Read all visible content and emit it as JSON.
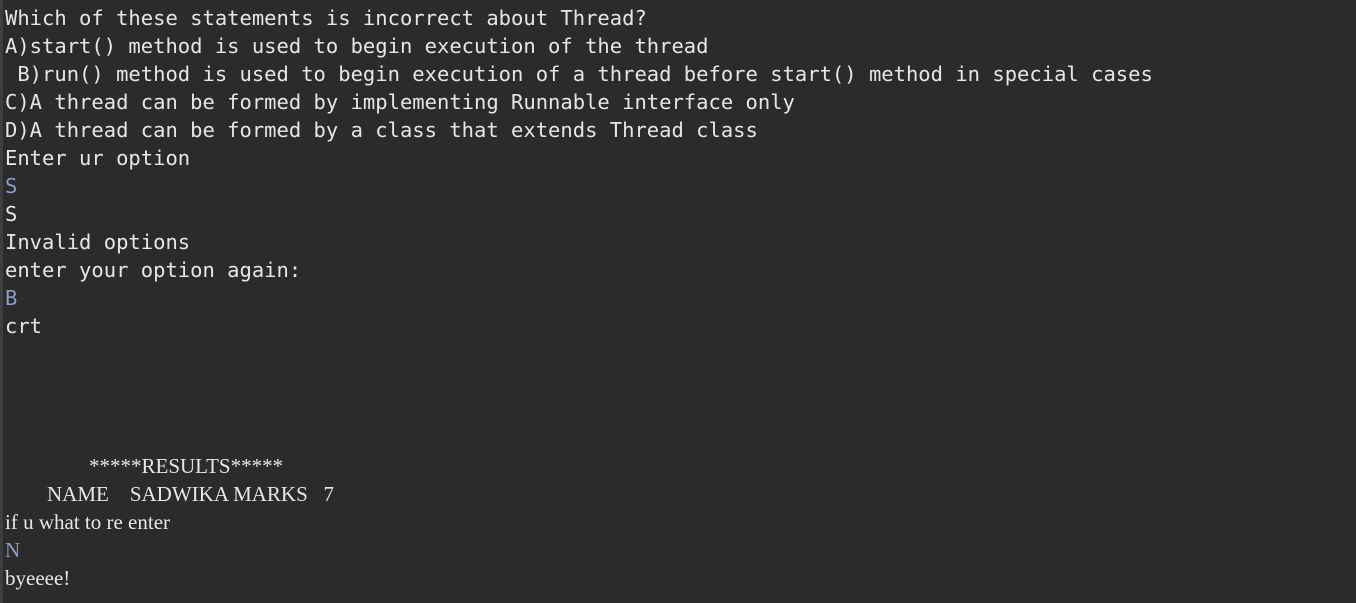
{
  "colors": {
    "background": "#2b2b2b",
    "output_text": "#e6e6e6",
    "input_text": "#8a9ec9"
  },
  "console": {
    "question": "Which of these statements is incorrect about Thread?",
    "option_a": "A)start() method is used to begin execution of the thread",
    "option_b": " B)run() method is used to begin execution of a thread before start() method in special cases",
    "option_c": "C)A thread can be formed by implementing Runnable interface only",
    "option_d": "D)A thread can be formed by a class that extends Thread class",
    "prompt": "Enter ur option",
    "user_input_1": "S",
    "echo_1": "S",
    "invalid": "Invalid options",
    "prompt_again": "enter your option again:",
    "user_input_2": "B",
    "result_crt": "crt",
    "results_header": "                *****RESULTS*****",
    "results_line": "        NAME    SADWIKA MARKS   7",
    "reenter_prompt": "if u what to re enter",
    "user_input_3": "N",
    "goodbye": "byeeee!"
  }
}
